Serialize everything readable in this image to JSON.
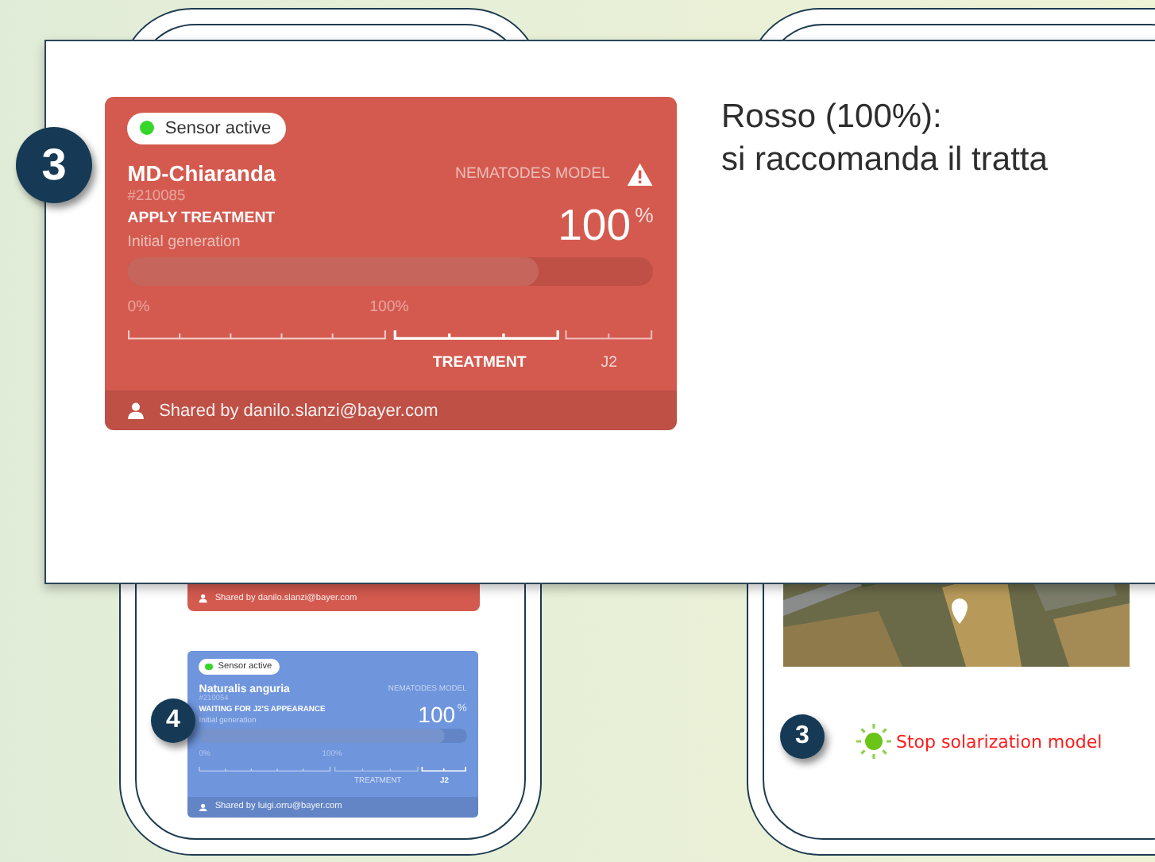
{
  "callout": {
    "badge": "3",
    "card": {
      "color": "#d45a4f",
      "sensor": {
        "label": "Sensor active",
        "active": true
      },
      "name": "MD-Chiaranda",
      "id": "#210085",
      "model": "NEMATODES MODEL",
      "warning": true,
      "status": "APPLY TREATMENT",
      "stage": "Initial generation",
      "percent": "100",
      "unit": "%",
      "level": 0.78,
      "scale_start": "0%",
      "scale_mid": "100%",
      "phases": [
        {
          "label": "TREATMENT",
          "selected": true
        },
        {
          "label": "J2",
          "selected": false
        }
      ],
      "shared": "Shared by danilo.slanzi@bayer.com"
    },
    "caption": [
      "Rosso (100%):",
      "si raccomanda il tratta"
    ]
  },
  "left_phone": {
    "peek_card": {
      "color": "#d45a4f",
      "shared": "Shared by danilo.slanzi@bayer.com"
    },
    "badge": "4",
    "card": {
      "color": "#6f95dd",
      "sensor": {
        "label": "Sensor active",
        "active": true
      },
      "name": "Naturalis anguria",
      "id": "#210054",
      "model": "NEMATODES MODEL",
      "warning": false,
      "status": "WAITING FOR J2'S APPEARANCE",
      "stage": "Initial generation",
      "percent": "100",
      "unit": "%",
      "level": 0.92,
      "scale_start": "0%",
      "scale_mid": "100%",
      "phases": [
        {
          "label": "TREATMENT",
          "selected": false
        },
        {
          "label": "J2",
          "selected": true
        }
      ],
      "shared": "Shared by luigi.orru@bayer.com"
    }
  },
  "right_phone": {
    "badge": "3",
    "status": {
      "text": "Stop solarization model"
    }
  }
}
